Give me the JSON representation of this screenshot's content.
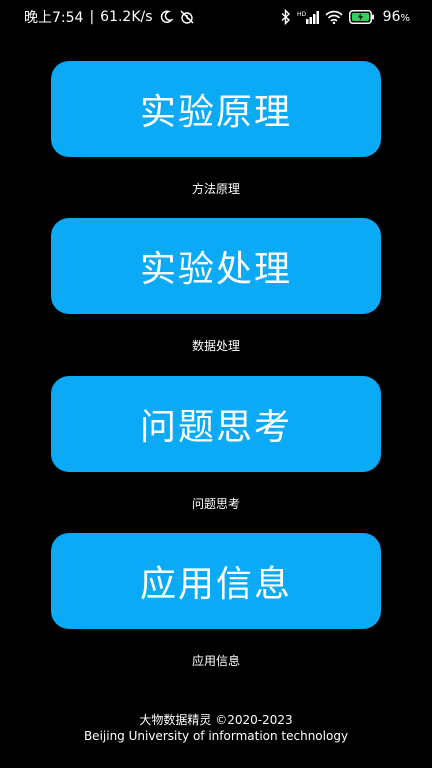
{
  "status_bar": {
    "time": "晚上7:54",
    "network_speed": "61.2K/s",
    "battery_percent": "96",
    "battery_unit": "%",
    "icons": [
      "moon-icon",
      "alarm-off-icon",
      "bluetooth-icon",
      "hd-signal-icon",
      "signal-icon",
      "wifi-icon",
      "battery-charging-icon"
    ]
  },
  "menu": [
    {
      "label": "实验原理",
      "caption": "方法原理"
    },
    {
      "label": "实验处理",
      "caption": "数据处理"
    },
    {
      "label": "问题思考",
      "caption": "问题思考"
    },
    {
      "label": "应用信息",
      "caption": "应用信息"
    }
  ],
  "footer": {
    "line1": "大物数据精灵 ©2020-2023",
    "line2": "Beijing University of information technology"
  },
  "colors": {
    "background": "#000000",
    "button": "#0aaaf7",
    "text": "#ffffff",
    "battery_fill": "#34d058"
  }
}
